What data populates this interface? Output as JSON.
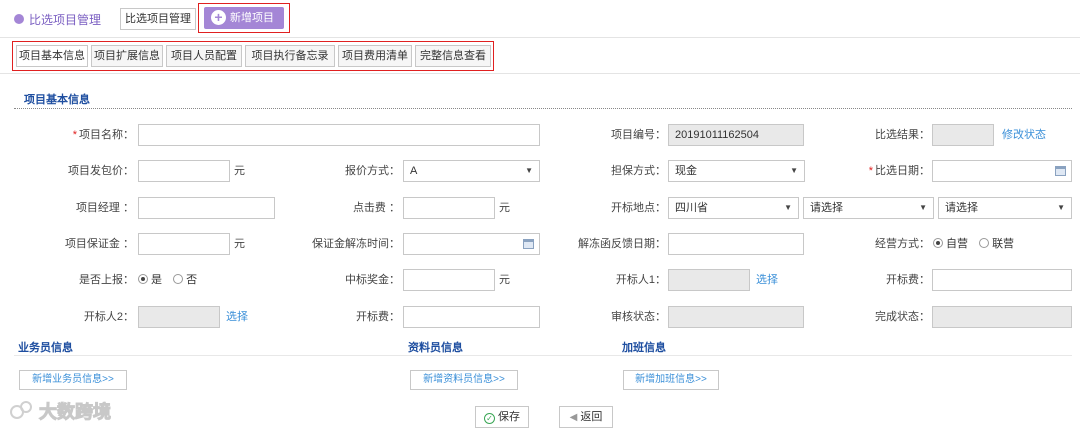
{
  "header": {
    "title": "比选项目管理",
    "breadcrumb_button": "比选项目管理",
    "new_button": "新增项目"
  },
  "tabs": [
    "项目基本信息",
    "项目扩展信息",
    "项目人员配置",
    "项目执行备忘录",
    "项目费用清单",
    "完整信息查看"
  ],
  "section_title": "项目基本信息",
  "form": {
    "project_name_label": "项目名称：",
    "project_no_label": "项目编号：",
    "project_no_value": "20191011162504",
    "result_label": "比选结果：",
    "modify_status_link": "修改状态",
    "package_price_label": "项目发包价：",
    "unit_yuan": "元",
    "quote_method_label": "报价方式：",
    "quote_method_value": "A",
    "guarantee_label": "担保方式：",
    "guarantee_value": "现金",
    "compare_date_label": "比选日期：",
    "manager_label": "项目经理 ：",
    "click_fee_label": "点击费 ：",
    "open_place_label": "开标地点：",
    "province_value": "四川省",
    "city_placeholder": "请选择",
    "district_placeholder": "请选择",
    "deposit_label": "项目保证金 ：",
    "deposit_thaw_label": "保证金解冻时间：",
    "thaw_feedback_label": "解冻函反馈日期：",
    "business_mode_label": "经营方式：",
    "business_mode_options": [
      "自营",
      "联营"
    ],
    "report_label": "是否上报：",
    "report_options": [
      "是",
      "否"
    ],
    "bid_bonus_label": "中标奖金：",
    "opener1_label": "开标人1：",
    "select_link": "选择",
    "open_fee_label": "开标费：",
    "opener2_label": "开标人2：",
    "open_cost_label": "开标费：",
    "audit_label": "审核状态：",
    "done_label": "完成状态："
  },
  "subsections": {
    "salesman": "业务员信息",
    "material": "资料员信息",
    "overtime": "加班信息",
    "add_salesman": "新增业务员信息>>",
    "add_material": "新增资料员信息>>",
    "add_overtime": "新增加班信息>>"
  },
  "footer": {
    "save": "保存",
    "back": "返回",
    "watermark": "大数跨境"
  },
  "colors": {
    "accent": "#a486d6",
    "section_title": "#1e4ea0",
    "link": "#3a8fd8",
    "highlight_border": "#e02020"
  }
}
